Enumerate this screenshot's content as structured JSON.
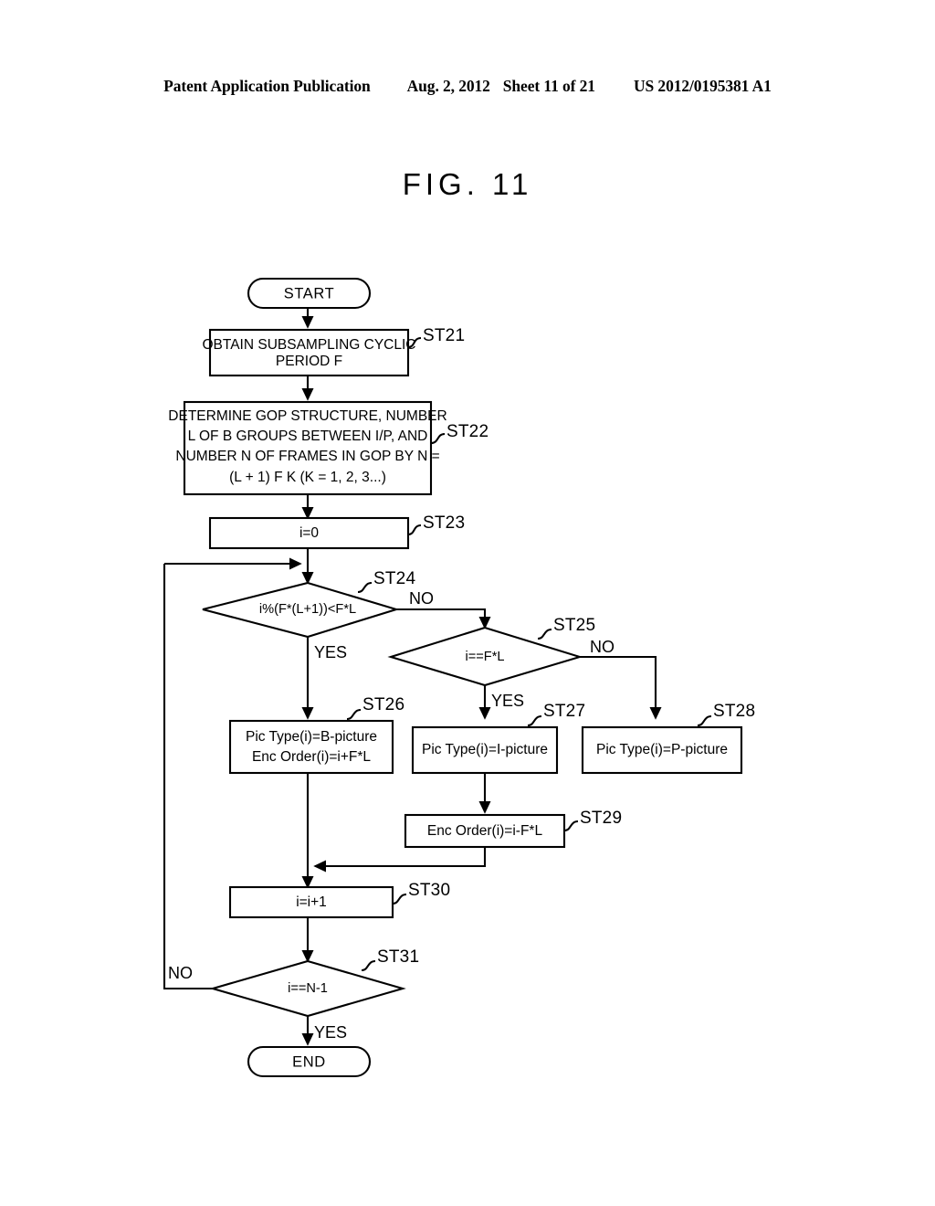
{
  "header": {
    "publication": "Patent Application Publication",
    "date": "Aug. 2, 2012",
    "sheet": "Sheet 11 of 21",
    "patent_number": "US 2012/0195381 A1"
  },
  "figure": {
    "title": "FIG. 11"
  },
  "flowchart": {
    "start_label": "START",
    "end_label": "END",
    "branch_yes": "YES",
    "branch_no": "NO",
    "steps": {
      "st21": {
        "id": "ST21",
        "lines": [
          "OBTAIN SUBSAMPLING CYCLIC",
          "PERIOD F"
        ]
      },
      "st22": {
        "id": "ST22",
        "lines": [
          "DETERMINE GOP STRUCTURE, NUMBER",
          "L OF B GROUPS BETWEEN I/P, AND",
          "NUMBER N OF FRAMES IN GOP BY N =",
          "(L + 1)  F  K (K = 1, 2, 3...)"
        ]
      },
      "st23": {
        "id": "ST23",
        "lines": [
          "i=0"
        ]
      },
      "st24": {
        "id": "ST24",
        "lines": [
          "i%(F*(L+1))<F*L"
        ],
        "yes": "YES",
        "no": "NO"
      },
      "st25": {
        "id": "ST25",
        "lines": [
          "i==F*L"
        ],
        "yes": "YES",
        "no": "NO"
      },
      "st26": {
        "id": "ST26",
        "lines": [
          "Pic Type(i)=B-picture",
          "Enc Order(i)=i+F*L"
        ]
      },
      "st27": {
        "id": "ST27",
        "lines": [
          "Pic Type(i)=I-picture"
        ]
      },
      "st28": {
        "id": "ST28",
        "lines": [
          "Pic Type(i)=P-picture"
        ]
      },
      "st29": {
        "id": "ST29",
        "lines": [
          "Enc Order(i)=i-F*L"
        ]
      },
      "st30": {
        "id": "ST30",
        "lines": [
          "i=i+1"
        ]
      },
      "st31": {
        "id": "ST31",
        "lines": [
          "i==N-1"
        ],
        "yes": "YES",
        "no": "NO"
      }
    }
  },
  "colors": {
    "ink": "#000000",
    "paper": "#ffffff"
  }
}
